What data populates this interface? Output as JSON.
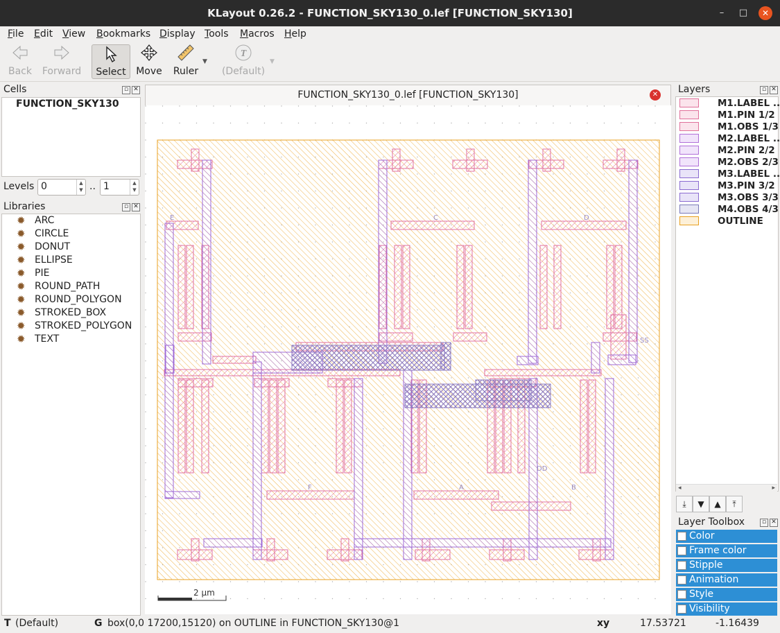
{
  "window": {
    "title": "KLayout 0.26.2 - FUNCTION_SKY130_0.lef [FUNCTION_SKY130]",
    "min_glyph": "–",
    "max_glyph": "□",
    "close_glyph": "✕"
  },
  "menu": [
    "File",
    "Edit",
    "View",
    "Bookmarks",
    "Display",
    "Tools",
    "Macros",
    "Help"
  ],
  "toolbar": {
    "back": "Back",
    "forward": "Forward",
    "select": "Select",
    "move": "Move",
    "ruler": "Ruler",
    "mode": "(Default)"
  },
  "cells": {
    "title": "Cells",
    "items": [
      "FUNCTION_SKY130"
    ]
  },
  "levels": {
    "label": "Levels",
    "from": "0",
    "sep": "..",
    "to": "1"
  },
  "libraries": {
    "title": "Libraries",
    "items": [
      "ARC",
      "CIRCLE",
      "DONUT",
      "ELLIPSE",
      "PIE",
      "ROUND_PATH",
      "ROUND_POLYGON",
      "STROKED_BOX",
      "STROKED_POLYGON",
      "TEXT"
    ]
  },
  "canvas": {
    "tab_title": "FUNCTION_SKY130_0.lef [FUNCTION_SKY130]",
    "scale_label": "2 µm",
    "pin_labels": [
      "E",
      "C",
      "D",
      "SS",
      "F",
      "A",
      "B",
      "DD"
    ]
  },
  "layers": {
    "title": "Layers",
    "items": [
      {
        "name": "M1.LABEL ...",
        "color": "#e0709a"
      },
      {
        "name": "M1.PIN 1/2",
        "color": "#e0709a"
      },
      {
        "name": "M1.OBS 1/3",
        "color": "#e0709a"
      },
      {
        "name": "M2.LABEL ...",
        "color": "#b070d8"
      },
      {
        "name": "M2.PIN 2/2",
        "color": "#b070d8"
      },
      {
        "name": "M2.OBS 2/3",
        "color": "#b070d8"
      },
      {
        "name": "M3.LABEL ...",
        "color": "#8a6ad0"
      },
      {
        "name": "M3.PIN 3/2",
        "color": "#8a6ad0"
      },
      {
        "name": "M3.OBS 3/3",
        "color": "#8a6ad0"
      },
      {
        "name": "M4.OBS 4/3",
        "color": "#7a7ab8"
      },
      {
        "name": "OUTLINE",
        "color": "#e8a020"
      }
    ]
  },
  "layer_toolbox": {
    "title": "Layer Toolbox",
    "items": [
      "Color",
      "Frame color",
      "Stipple",
      "Animation",
      "Style",
      "Visibility"
    ]
  },
  "statusbar": {
    "t_key": "T",
    "mode": "(Default)",
    "g_key": "G",
    "info": "box(0,0 17200,15120) on OUTLINE in FUNCTION_SKY130@1",
    "xy_label": "xy",
    "x": "17.53721",
    "y": "-1.16439"
  }
}
